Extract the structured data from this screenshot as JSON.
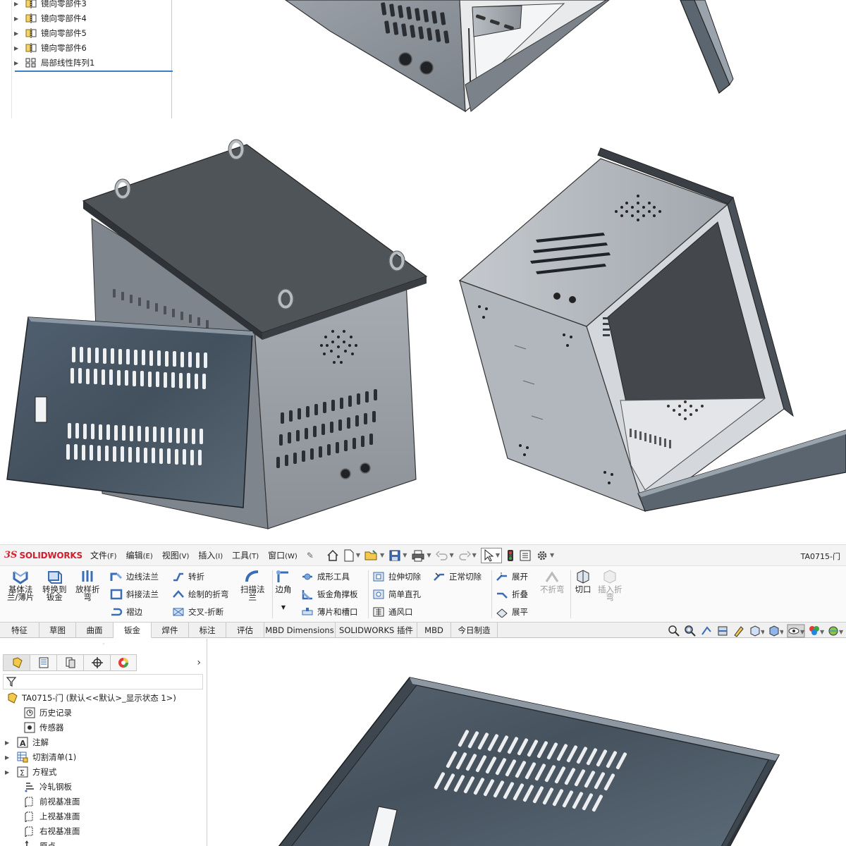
{
  "top_tree": {
    "items": [
      {
        "label": "镜向零部件3"
      },
      {
        "label": "镜向零部件4"
      },
      {
        "label": "镜向零部件5"
      },
      {
        "label": "镜向零部件6"
      },
      {
        "label": "局部线性阵列1"
      }
    ]
  },
  "app": {
    "logo_ds": "3S",
    "logo_name": "SOLIDWORKS",
    "doc_title": "TA0715-门"
  },
  "menu": {
    "items": [
      {
        "label": "文件",
        "key": "(F)"
      },
      {
        "label": "编辑",
        "key": "(E)"
      },
      {
        "label": "视图",
        "key": "(V)"
      },
      {
        "label": "插入",
        "key": "(I)"
      },
      {
        "label": "工具",
        "key": "(T)"
      },
      {
        "label": "窗口",
        "key": "(W)"
      }
    ]
  },
  "ribbon": {
    "base_flange": "基体法\n兰/薄片",
    "convert_sheet": "转换到\n钣金",
    "lofted_bend": "放样折\n弯",
    "edge_flange": "边线法兰",
    "miter_flange": "斜接法兰",
    "hem": "褶边",
    "jog": "转折",
    "sketched_bend": "绘制的折弯",
    "cross_break": "交叉-折断",
    "swept_flange": "扫描法\n兰",
    "corner": "边角",
    "forming_tool": "成形工具",
    "gusset": "钣金角撑板",
    "tab_slot": "薄片和槽口",
    "extruded_cut": "拉伸切除",
    "simple_hole": "简单直孔",
    "vent": "通风口",
    "normal_cut": "正常切除",
    "unfold": "展开",
    "fold": "折叠",
    "flatten": "展平",
    "no_bends": "不折弯",
    "rip": "切口",
    "insert_bends": "插入折\n弯"
  },
  "command_tabs": [
    {
      "label": "特征"
    },
    {
      "label": "草图"
    },
    {
      "label": "曲面"
    },
    {
      "label": "钣金"
    },
    {
      "label": "焊件"
    },
    {
      "label": "标注"
    },
    {
      "label": "评估"
    },
    {
      "label": "MBD Dimensions"
    },
    {
      "label": "SOLIDWORKS 插件"
    },
    {
      "label": "MBD"
    },
    {
      "label": "今日制造"
    }
  ],
  "active_tab": "钣金",
  "feature_tree": {
    "root": "TA0715-门  (默认<<默认>_显示状态 1>)",
    "items": [
      {
        "label": "历史记录"
      },
      {
        "label": "传感器"
      },
      {
        "label": "注解"
      },
      {
        "label": "切割清单(1)"
      },
      {
        "label": "方程式"
      },
      {
        "label": "冷轧钢板"
      },
      {
        "label": "前视基准面"
      },
      {
        "label": "上视基准面"
      },
      {
        "label": "右视基准面"
      },
      {
        "label": "原点"
      }
    ]
  },
  "colors": {
    "accent_red": "#d2202f",
    "selection_blue": "#3c7fc4",
    "steel": "#8e949c",
    "dark_panel": "#4a5561"
  }
}
